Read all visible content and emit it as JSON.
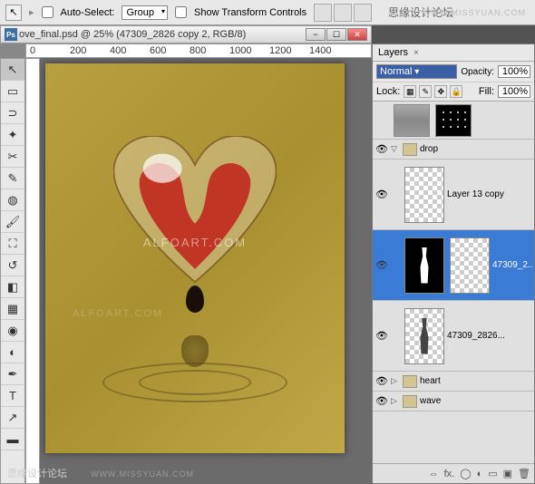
{
  "options": {
    "auto_select": "Auto-Select:",
    "group": "Group",
    "show_transform": "Show Transform Controls"
  },
  "watermark": {
    "top_cn": "思缘设计论坛",
    "top_url": "WWW.MISSYUAN.COM",
    "bottom_cn": "思缘设计论坛",
    "bottom_url": "WWW.MISSYUAN.COM",
    "canvas1": "ALFOART.COM",
    "canvas2": "ALFOART.COM"
  },
  "document": {
    "title": "ove_final.psd @ 25% (47309_2826 copy 2, RGB/8)"
  },
  "ruler": {
    "t0": "0",
    "t1": "200",
    "t2": "400",
    "t3": "600",
    "t4": "800",
    "t5": "1000",
    "t6": "1200",
    "t7": "1400"
  },
  "panel": {
    "tab": "Layers",
    "blend_mode": "Normal",
    "opacity_label": "Opacity:",
    "opacity_value": "100%",
    "lock_label": "Lock:",
    "fill_label": "Fill:",
    "fill_value": "100%"
  },
  "layers": {
    "drop_group": "drop",
    "layer13": "Layer 13 copy",
    "sel": "47309_2...",
    "below": "47309_2826...",
    "heart_group": "heart",
    "wave_group": "wave"
  },
  "footer": {
    "link": "⇔",
    "fx": "fx.",
    "mask": "◯",
    "adj": "◐",
    "folder": "▭",
    "new": "▣",
    "trash": "🗑"
  }
}
